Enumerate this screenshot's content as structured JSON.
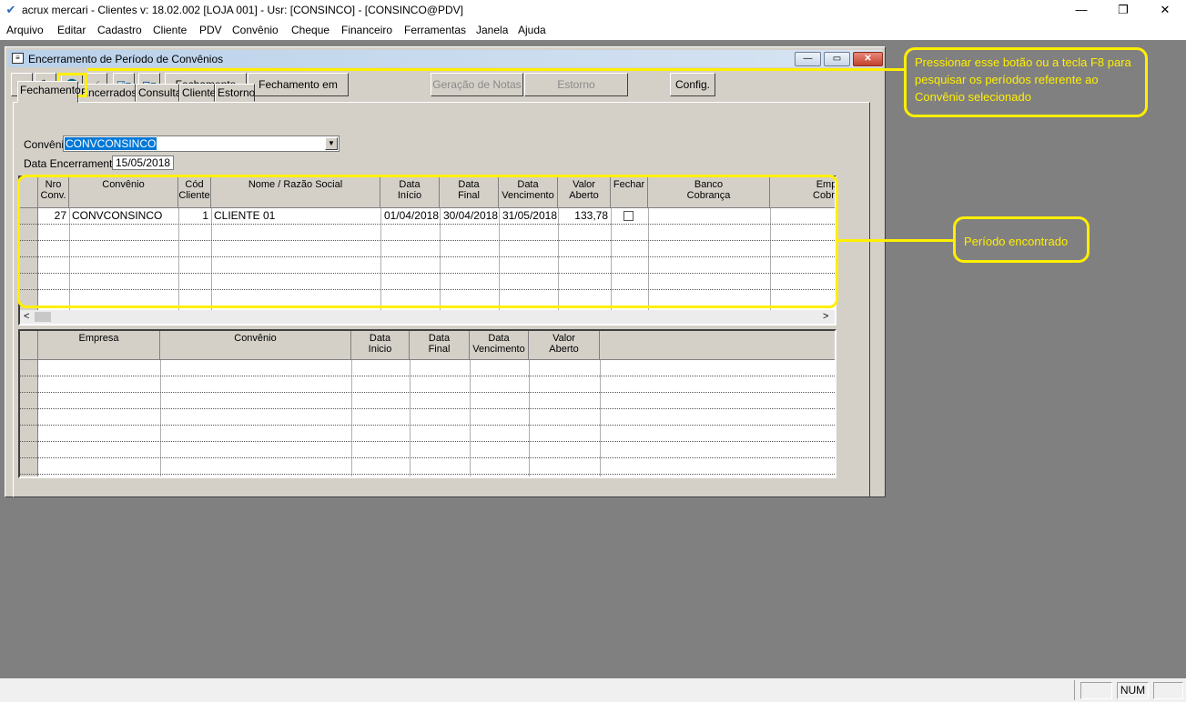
{
  "window": {
    "title": "acrux mercari - Clientes  v: 18.02.002  [LOJA 001] - Usr: [CONSINCO] - [CONSINCO@PDV]"
  },
  "menu": [
    "Arquivo",
    "Editar",
    "Cadastro",
    "Cliente",
    "PDV",
    "Convênio",
    "Cheque",
    "Financeiro",
    "Ferramentas",
    "Janela",
    "Ajuda"
  ],
  "child": {
    "title": "Encerramento de Período de Convênios",
    "toolbar": {
      "fechamento": "Fechamento",
      "fechamento_lote": "Fechamento em Lote",
      "geracao_notas": "Geração de Notas",
      "estorno": "Estorno",
      "config": "Config."
    },
    "tabs": [
      "Fechamento",
      "Encerrados",
      "Consulta",
      "Cliente",
      "Estorno"
    ],
    "form": {
      "convenio_label": "Convênio",
      "convenio_value": "CONVCONSINCO",
      "data_label": "Data Encerramento",
      "data_value": "15/05/2018"
    },
    "grid1": {
      "headers": {
        "nro": "Nro\nConv.",
        "convenio": "Convênio",
        "cod": "Cód\nCliente",
        "nome": "Nome / Razão Social",
        "inicio": "Data\nInício",
        "final": "Data\nFinal",
        "venc": "Data\nVencimento",
        "valor": "Valor\nAberto",
        "fechar": "Fechar",
        "banco": "Banco\nCobrança",
        "empresa": "Empr\nCobra"
      },
      "row": {
        "nro": "27",
        "convenio": "CONVCONSINCO",
        "cod": "1",
        "nome": "CLIENTE 01",
        "inicio": "01/04/2018",
        "final": "30/04/2018",
        "venc": "31/05/2018",
        "valor": "133,78"
      }
    },
    "grid2": {
      "headers": {
        "empresa": "Empresa",
        "convenio": "Convênio",
        "inicio": "Data\nInicio",
        "final": "Data\nFinal",
        "venc": "Data\nVencimento",
        "valor": "Valor\nAberto"
      }
    }
  },
  "callouts": {
    "search": "Pressionar esse botão ou a tecla F8 para pesquisar os períodos referente ao Convênio selecionado",
    "found": "Período encontrado"
  },
  "status": {
    "num": "NUM"
  },
  "colors": {
    "highlight": "#ffef00",
    "selection": "#0078d7",
    "mdi_background": "#808080"
  },
  "icons": [
    "app-icon",
    "exit-icon",
    "pencil-icon",
    "binoculars-icon",
    "check-icon",
    "checklist-icon",
    "tree-icon",
    "window-icon",
    "minimize-icon",
    "restore-icon",
    "close-icon",
    "dropdown-arrow-icon",
    "scroll-left-icon",
    "scroll-right-icon"
  ]
}
